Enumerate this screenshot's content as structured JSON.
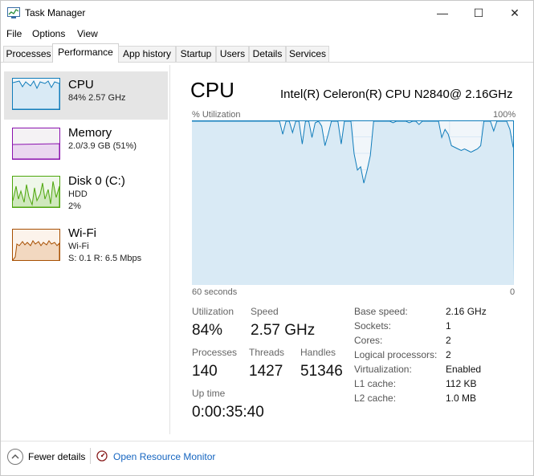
{
  "window": {
    "title": "Task Manager",
    "controls": {
      "minimize": "—",
      "maximize": "☐",
      "close": "✕"
    }
  },
  "menu": [
    "File",
    "Options",
    "View"
  ],
  "tabs": [
    "Processes",
    "Performance",
    "App history",
    "Startup",
    "Users",
    "Details",
    "Services"
  ],
  "active_tab": "Performance",
  "sidebar": {
    "items": [
      {
        "name": "CPU",
        "sub": [
          "84%  2.57 GHz"
        ],
        "color": "#117dbb",
        "fill": "#f1f6fa"
      },
      {
        "name": "Memory",
        "sub": [
          "2.0/3.9 GB (51%)"
        ],
        "color": "#8b12ae",
        "fill": "#f4f2f4"
      },
      {
        "name": "Disk 0 (C:)",
        "sub": [
          "HDD",
          "2%"
        ],
        "color": "#4da60c",
        "fill": "#eff7ea"
      },
      {
        "name": "Wi-Fi",
        "sub": [
          "Wi-Fi",
          "S: 0.1  R: 6.5 Mbps"
        ],
        "color": "#a74f01",
        "fill": "#fcf3eb"
      }
    ]
  },
  "main": {
    "title": "CPU",
    "model": "Intel(R) Celeron(R) CPU N2840@ 2.16GHz",
    "util_label": "% Utilization",
    "util_max": "100%",
    "axis_left": "60 seconds",
    "axis_right": "0",
    "stats": {
      "utilization": {
        "label": "Utilization",
        "value": "84%"
      },
      "speed": {
        "label": "Speed",
        "value": "2.57 GHz"
      },
      "processes": {
        "label": "Processes",
        "value": "140"
      },
      "threads": {
        "label": "Threads",
        "value": "1427"
      },
      "handles": {
        "label": "Handles",
        "value": "51346"
      },
      "uptime": {
        "label": "Up time",
        "value": "0:00:35:40"
      }
    },
    "specs": [
      {
        "label": "Base speed:",
        "value": "2.16 GHz"
      },
      {
        "label": "Sockets:",
        "value": "1"
      },
      {
        "label": "Cores:",
        "value": "2"
      },
      {
        "label": "Logical processors:",
        "value": "2"
      },
      {
        "label": "Virtualization:",
        "value": "Enabled"
      },
      {
        "label": "L1 cache:",
        "value": "112 KB"
      },
      {
        "label": "L2 cache:",
        "value": "1.0 MB"
      }
    ]
  },
  "cpu_history": [
    100,
    100,
    100,
    100,
    100,
    100,
    100,
    100,
    100,
    100,
    100,
    100,
    100,
    100,
    100,
    100,
    100,
    100,
    100,
    100,
    100,
    100,
    100,
    100,
    100,
    100,
    100,
    100,
    92,
    100,
    100,
    93,
    100,
    100,
    86,
    100,
    100,
    90,
    99,
    100,
    97,
    85,
    92,
    100,
    100,
    100,
    86,
    100,
    100,
    100,
    80,
    70,
    72,
    62,
    70,
    79,
    100,
    100,
    100,
    100,
    100,
    100,
    99,
    100,
    100,
    100,
    100,
    99,
    100,
    100,
    98,
    100,
    100,
    100,
    100,
    100,
    100,
    90,
    95,
    92,
    85,
    84,
    83,
    82,
    83,
    82,
    81,
    82,
    83,
    85,
    100,
    100,
    100,
    94,
    100,
    100,
    100,
    100,
    95,
    84
  ],
  "colors": {
    "cpu": "#117dbb",
    "link": "#1565c0"
  },
  "footer": {
    "fewer_details": "Fewer details",
    "open_resource_monitor": "Open Resource Monitor"
  }
}
